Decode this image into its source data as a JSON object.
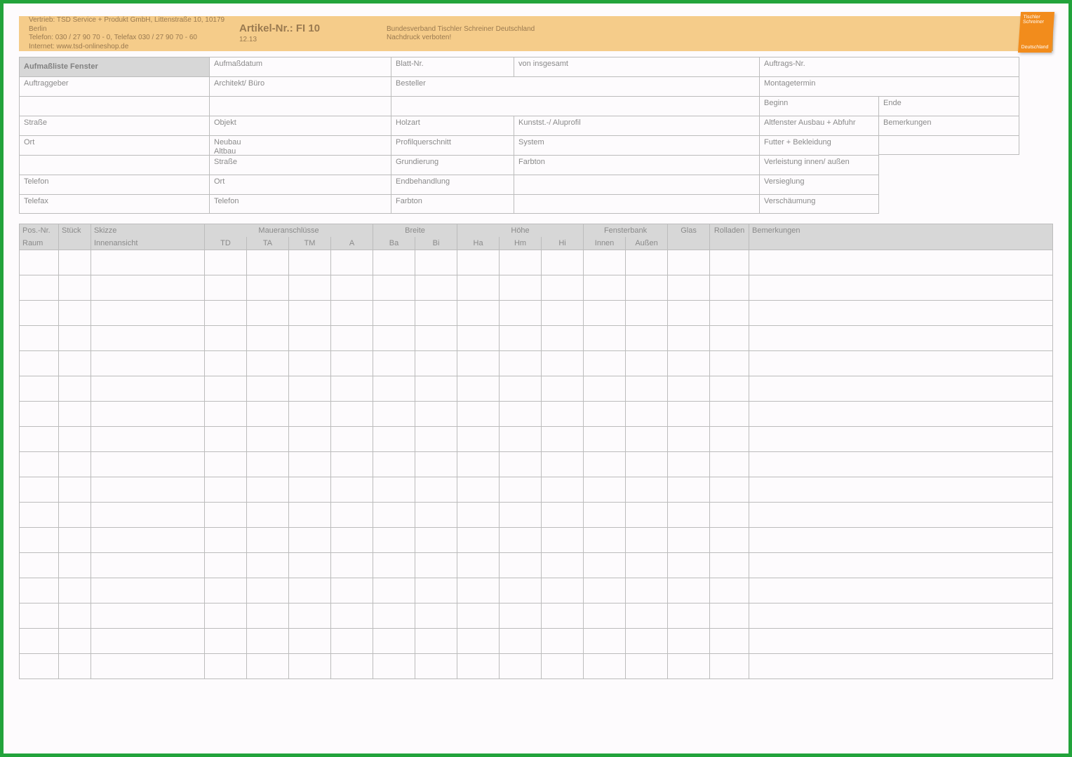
{
  "header": {
    "distrib_line1": "Vertrieb: TSD Service + Produkt GmbH, Littenstraße 10, 10179 Berlin",
    "distrib_line2": "Telefon: 030 / 27 90 70 - 0, Telefax 030 / 27 90 70 - 60",
    "distrib_line3": "Internet: www.tsd-onlineshop.de",
    "artikel_nr": "Artikel-Nr.: FI 10",
    "version": "12.13",
    "assoc_line1": "Bundesverband Tischler Schreiner Deutschland",
    "assoc_line2": "Nachdruck verboten!",
    "logo_top": "Tischler Schreiner",
    "logo_bot": "Deutschland"
  },
  "title": "Aufmaßliste Fenster",
  "top": {
    "aufmassdatum": "Aufmaßdatum",
    "blatt_nr": "Blatt-Nr.",
    "von_insg": "von insgesamt",
    "auftrags_nr": "Auftrags-Nr.",
    "auftraggeber": "Auftraggeber",
    "architekt": "Architekt/ Büro",
    "besteller": "Besteller",
    "montagetermin": "Montagetermin",
    "beginn": "Beginn",
    "ende": "Ende",
    "strasse_l": "Straße",
    "objekt": "Objekt",
    "holzart": "Holzart",
    "kunst_alu": "Kunstst.-/ Aluprofil",
    "altfenster": "Altfenster Ausbau + Abfuhr",
    "bem": "Bemerkungen",
    "ort_l": "Ort",
    "neubau_altbau1": "Neubau",
    "neubau_altbau2": "Altbau",
    "profilq": "Profilquerschnitt",
    "system": "System",
    "futter": "Futter + Bekleidung",
    "strasse_r": "Straße",
    "grund": "Grundierung",
    "farbton1": "Farbton",
    "verleist": "Verleistung innen/ außen",
    "telefon_l": "Telefon",
    "ort_r": "Ort",
    "endbeh": "Endbehandlung",
    "versieg": "Versieglung",
    "telefax": "Telefax",
    "telefon_r": "Telefon",
    "farbton2": "Farbton",
    "verschae": "Verschäumung"
  },
  "table": {
    "h_pos1": "Pos.-Nr.",
    "h_pos2": "Raum",
    "h_stueck": "Stück",
    "h_skizze1": "Skizze",
    "h_skizze2": "Innenansicht",
    "h_mauer": "Maueranschlüsse",
    "h_td": "TD",
    "h_ta": "TA",
    "h_tm": "TM",
    "h_a": "A",
    "h_breite": "Breite",
    "h_ba": "Ba",
    "h_bi": "Bi",
    "h_hoehe": "Höhe",
    "h_ha": "Ha",
    "h_hm": "Hm",
    "h_hi": "Hi",
    "h_fbank": "Fensterbank",
    "h_innen": "Innen",
    "h_aussen": "Außen",
    "h_glas": "Glas",
    "h_roll": "Rolladen",
    "h_bem": "Bemerkungen"
  }
}
